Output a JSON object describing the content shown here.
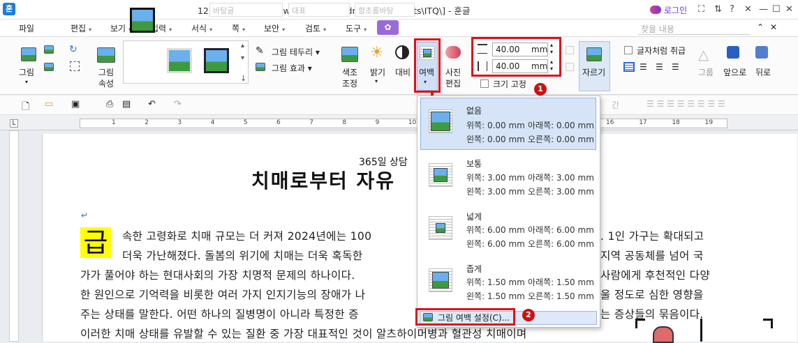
{
  "titlebar": {
    "app_icon": "훈",
    "title": "12345678-이순신3.hwp [C:\\Users\\admin\\Documents\\ITQ\\] - 훈글",
    "login": "로그인",
    "controls": [
      "⛶",
      "⇅",
      "?",
      "✕"
    ],
    "window_controls": [
      "—",
      "☐",
      "✕"
    ]
  },
  "menubar": {
    "items": [
      "파일",
      "편집",
      "보기",
      "입력",
      "서식",
      "쪽",
      "보안",
      "검토",
      "도구"
    ],
    "search_placeholder": "찾을 내용",
    "right_icons": [
      "⌃",
      "✕"
    ]
  },
  "ribbon": {
    "picture": "그림",
    "picture_props": "그림\n속성",
    "border": "그림 테두리",
    "effect": "그림 효과",
    "color_adjust": "색조\n조정",
    "brightness": "밝기",
    "contrast": "대비",
    "margin": "여백",
    "photo_edit": "사진\n편집",
    "width_value": "40.00",
    "height_value": "40.00",
    "unit": "mm",
    "fix_size": "크기 고정",
    "crop": "자르기",
    "no_char": "글자처럼 취급",
    "group": "그룹",
    "front": "앞으로",
    "back": "뒤로"
  },
  "toolbar2": {
    "style_field": "바탕글",
    "para_field": "대표",
    "font_field": "함초롬바탕",
    "char_icon": "간"
  },
  "ruler": {
    "numbers": [
      "1",
      "2",
      "3",
      "4",
      "5",
      "6",
      "7",
      "8",
      "9",
      "10",
      "11",
      "12",
      "13",
      "14",
      "15",
      "16",
      "17",
      "18",
      "19"
    ]
  },
  "document": {
    "subtitle": "365일 상담",
    "title": "치매로부터 자유",
    "para_mark": "↵",
    "dropcap": "급",
    "lines": [
      "속한 고령화로 치매 규모는 더 커져 2024년에는 100",
      ". 1인 가구는 확대되고",
      "더욱 가난해졌다. 돌봄의 위기에 치매는 더욱 혹독한",
      "지역 공동체를 넘어 국",
      "가가 풀어야 하는 현대사회의 가장 치명적 문제의 하나이다.",
      "사람에게 후천적인 다양",
      "한 원인으로 기억력을 비롯한 여러 가지 인지기능의 장애가 나",
      "울 정도로 심한 영향을",
      "주는 상태를 말한다. 어떤 하나의 질병명이 아니라 특정한 증",
      "는 증상들의 묶음이다.",
      "이러한 치매 상태를 유발할 수 있는 질환 중 가장 대표적인 것이 알츠하이머병과 혈관성 치매이며"
    ]
  },
  "dropdown": {
    "items": [
      {
        "name": "없음",
        "l1a": "위쪽: 0.00 mm",
        "l1b": "아래쪽: 0.00 mm",
        "l2a": "왼쪽: 0.00 mm",
        "l2b": "오른쪽: 0.00 mm"
      },
      {
        "name": "보통",
        "l1a": "위쪽: 3.00 mm",
        "l1b": "아래쪽: 3.00 mm",
        "l2a": "왼쪽: 3.00 mm",
        "l2b": "오른쪽: 3.00 mm"
      },
      {
        "name": "넓게",
        "l1a": "위쪽: 6.00 mm",
        "l1b": "아래쪽: 6.00 mm",
        "l2a": "왼쪽: 6.00 mm",
        "l2b": "오른쪽: 6.00 mm"
      },
      {
        "name": "좁게",
        "l1a": "위쪽: 1.50 mm",
        "l1b": "아래쪽: 1.50 mm",
        "l2a": "왼쪽: 1.50 mm",
        "l2b": "오른쪽: 1.50 mm"
      }
    ],
    "setting": "그림 여백 설정(C)..."
  },
  "badges": [
    "1",
    "2"
  ],
  "colors": {
    "highlight": "#e0101a",
    "accent": "#6a3ad8",
    "dropcap_bg": "#ffff00"
  }
}
